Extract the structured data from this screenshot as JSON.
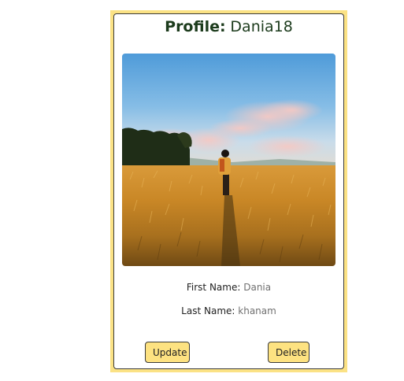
{
  "profile": {
    "title_label": "Profile:",
    "username": "Dania18",
    "photo_alt": "person walking through a golden rice field under a blue sky",
    "first_name_label": "First Name:",
    "first_name": "Dania",
    "last_name_label": "Last Name:",
    "last_name": "khanam"
  },
  "actions": {
    "update_label": "Update",
    "delete_label": "Delete"
  },
  "colors": {
    "card_border_accent": "#fbe285",
    "button_fill": "#fde281",
    "title_text": "#1c3b1c"
  }
}
